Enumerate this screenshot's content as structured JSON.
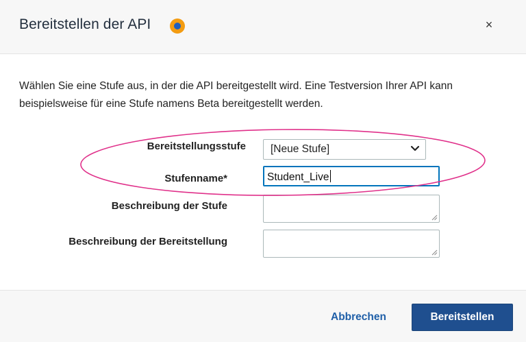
{
  "dialog": {
    "title": "Bereitstellen der API",
    "close_symbol": "×",
    "intro_text": "Wählen Sie eine Stufe aus, in der die API bereitgestellt wird. Eine Testversion Ihrer API kann beispielsweise für eine Stufe namens Beta bereitgestellt werden."
  },
  "form": {
    "stage_label": "Bereitstellungsstufe",
    "stage_value": "[Neue Stufe]",
    "stage_name_label": "Stufenname*",
    "stage_name_value": "Student_Live",
    "stage_description_label": "Beschreibung der Stufe",
    "deployment_description_label": "Beschreibung der Bereitstellung"
  },
  "footer": {
    "cancel_label": "Abbrechen",
    "deploy_label": "Bereitstellen"
  },
  "colors": {
    "info_icon_outer": "#f39c12",
    "info_icon_inner": "#1f5fbf",
    "primary_button": "#1f4f8f",
    "highlight_annotation": "#e0308a"
  },
  "icons": {
    "info": "info-dot-icon",
    "close": "close-icon",
    "select": "chevron-down-icon",
    "textarea_resize": "resize-handle-icon"
  }
}
